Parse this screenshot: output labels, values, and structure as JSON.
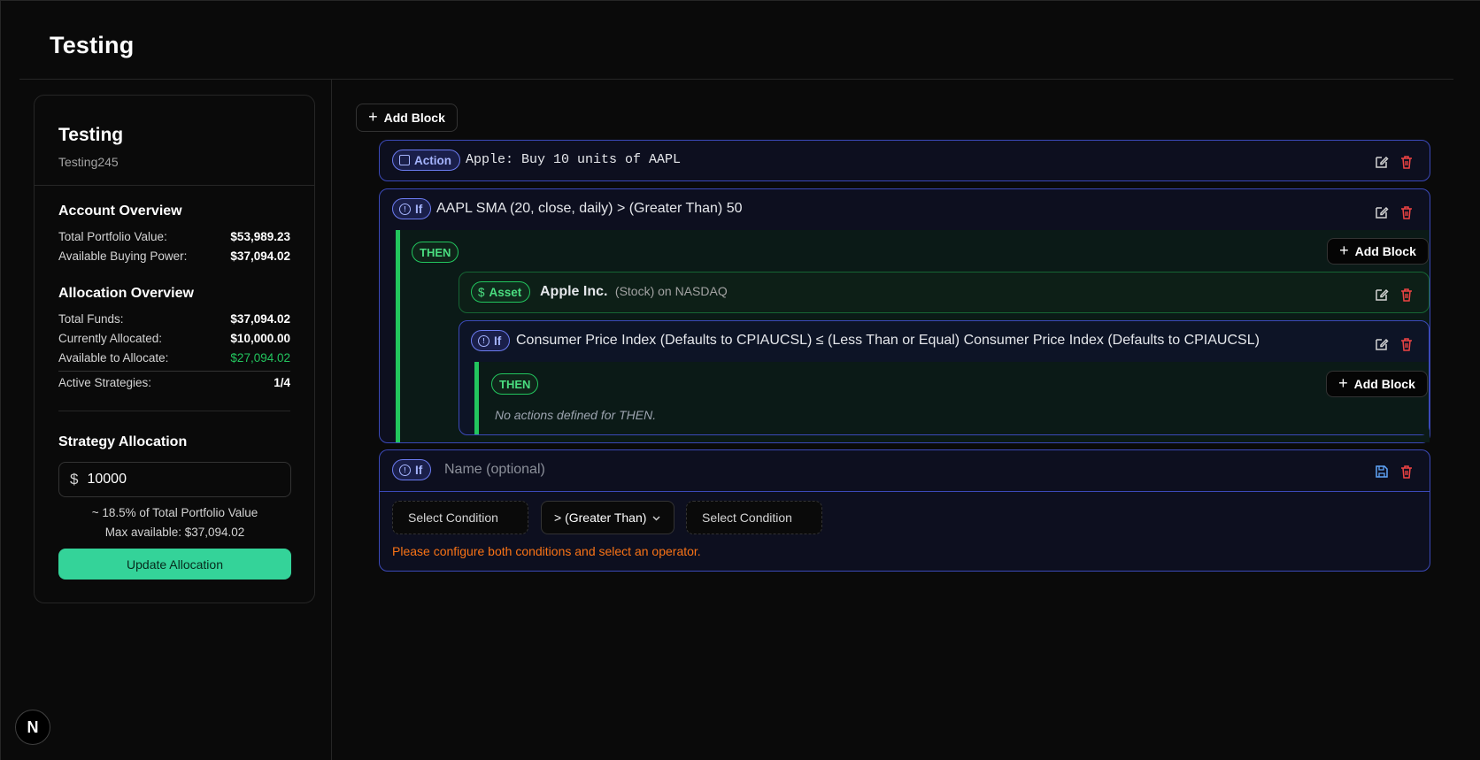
{
  "page": {
    "title": "Testing"
  },
  "sidebar": {
    "strategy_name": "Testing",
    "strategy_id": "Testing245",
    "account_overview": {
      "title": "Account Overview",
      "rows": [
        {
          "label": "Total Portfolio Value:",
          "value": "$53,989.23"
        },
        {
          "label": "Available Buying Power:",
          "value": "$37,094.02"
        }
      ]
    },
    "allocation_overview": {
      "title": "Allocation Overview",
      "rows": [
        {
          "label": "Total Funds:",
          "value": "$37,094.02"
        },
        {
          "label": "Currently Allocated:",
          "value": "$10,000.00"
        },
        {
          "label": "Available to Allocate:",
          "value": "$27,094.02"
        }
      ],
      "active_strategies_label": "Active Strategies:",
      "active_strategies_value": "1/4"
    },
    "strategy_allocation": {
      "title": "Strategy Allocation",
      "currency_symbol": "$",
      "input_value": "10000",
      "percent_note": "~ 18.5% of Total Portfolio Value",
      "max_note": "Max available: $37,094.02",
      "update_label": "Update Allocation"
    }
  },
  "builder": {
    "add_block_label": "Add Block",
    "blocks": {
      "action": {
        "badge": "Action",
        "text": "Apple: Buy 10 units of AAPL"
      },
      "if1": {
        "badge": "If",
        "text": "AAPL SMA (20, close, daily) > (Greater Than) 50",
        "then_label": "THEN",
        "add_block_label": "Add Block",
        "asset": {
          "badge": "Asset",
          "name": "Apple Inc.",
          "detail": "(Stock) on NASDAQ"
        },
        "nested_if": {
          "badge": "If",
          "text": "Consumer Price Index (Defaults to CPIAUCSL) ≤ (Less Than or Equal) Consumer Price Index (Defaults to CPIAUCSL)",
          "then_label": "THEN",
          "add_block_label": "Add Block",
          "empty_note": "No actions defined for THEN."
        }
      },
      "if_new": {
        "badge": "If",
        "name_placeholder": "Name (optional)",
        "left_condition": "Select Condition",
        "operator": "> (Greater Than)",
        "right_condition": "Select Condition",
        "error": "Please configure both conditions and select an operator."
      }
    }
  },
  "footer": {
    "badge_letter": "N"
  },
  "colors": {
    "accent_green": "#34d399",
    "block_border": "#3b49b8",
    "error": "#f97316"
  }
}
